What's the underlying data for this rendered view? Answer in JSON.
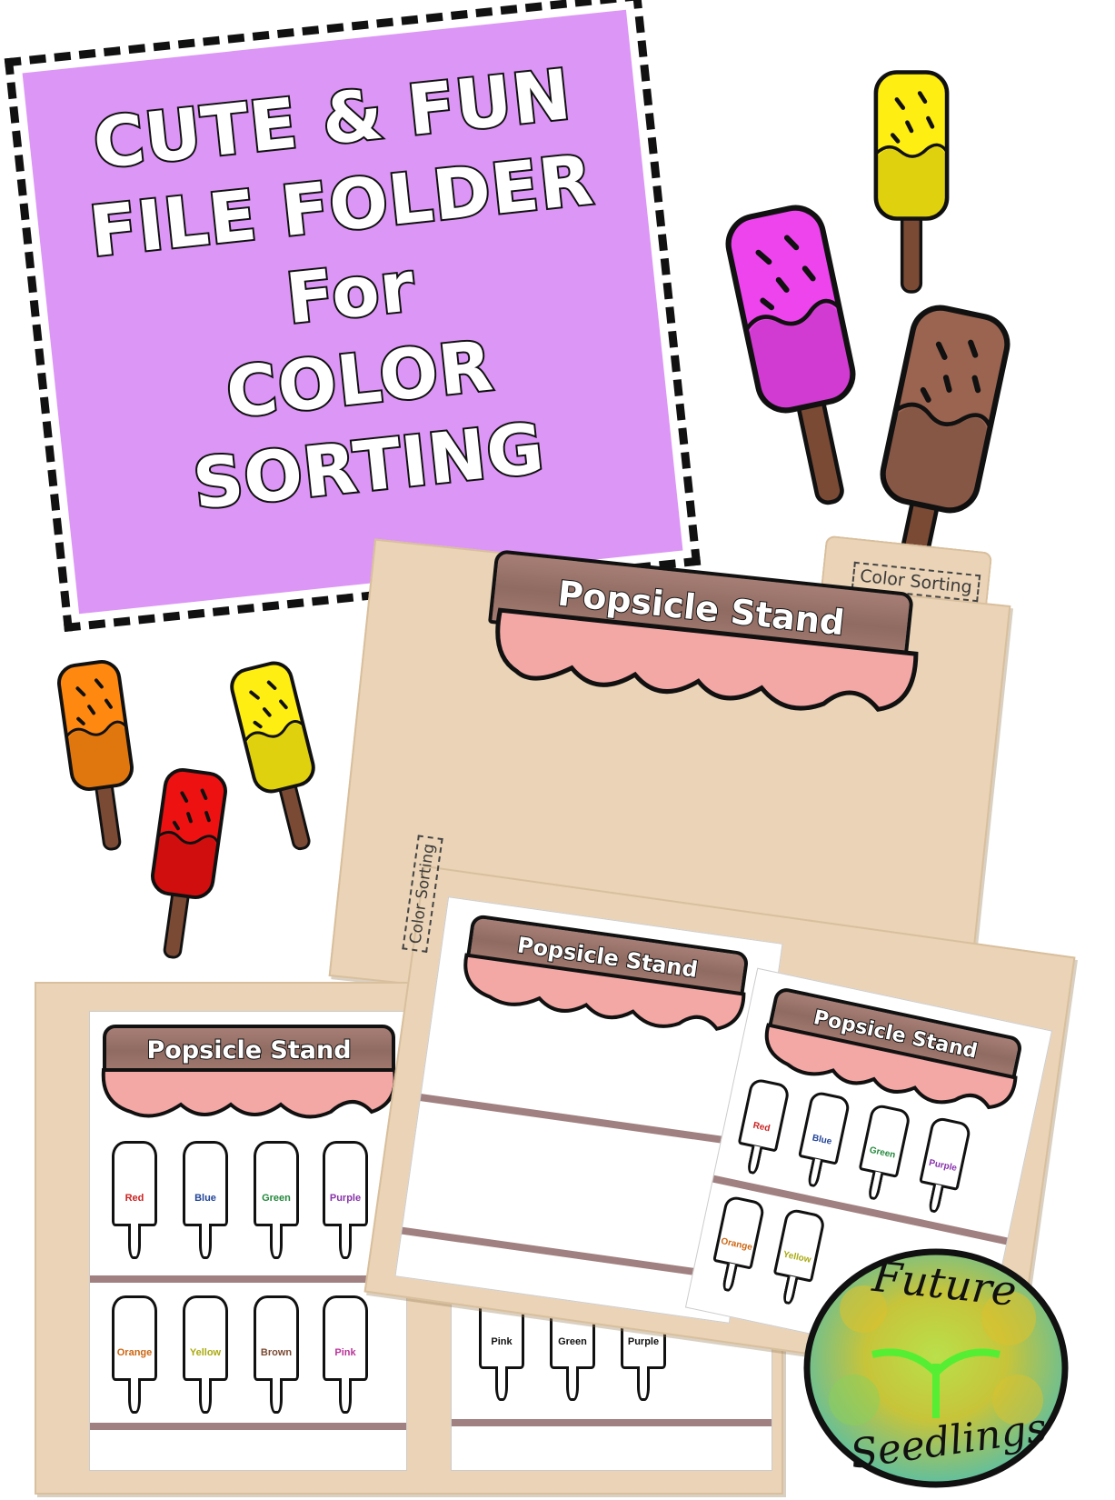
{
  "title": {
    "lines": [
      "CUTE & FUN",
      "FILE FOLDER",
      "For",
      "COLOR",
      "SORTING"
    ]
  },
  "folders": {
    "tab_label": "Color Sorting",
    "sign_text": "Popsicle Stand"
  },
  "worksheet_left": {
    "row1": [
      "Red",
      "Blue",
      "Green",
      "Purple"
    ],
    "row2": [
      "Orange",
      "Yellow",
      "Brown",
      "Pink"
    ]
  },
  "worksheet_bottom_mid": {
    "row": [
      "Pink",
      "Green",
      "Purple"
    ]
  },
  "worksheet_right": {
    "row1": [
      "Red",
      "Blue",
      "Green",
      "Purple"
    ],
    "row2": [
      "Orange",
      "Yellow"
    ]
  },
  "logo": {
    "line1": "Future",
    "line2": "Seedlings"
  },
  "colors": {
    "title_bg": "#dc96f5",
    "folder": "#ead3b6",
    "pink": "#ee44ee",
    "green": "#66cc22",
    "blue": "#11bbf0",
    "brown": "#9a6450",
    "red": "#ee1111",
    "orange": "#ff8811",
    "yellow": "#ffee11",
    "purple": "#9944ee",
    "label_red": "#cc2222",
    "label_blue": "#224499",
    "label_green": "#22883a",
    "label_purple": "#8833aa",
    "label_orange": "#cc6611",
    "label_yellow": "#aaaa11",
    "label_brown": "#7a4a33",
    "label_pink": "#bb3399"
  }
}
